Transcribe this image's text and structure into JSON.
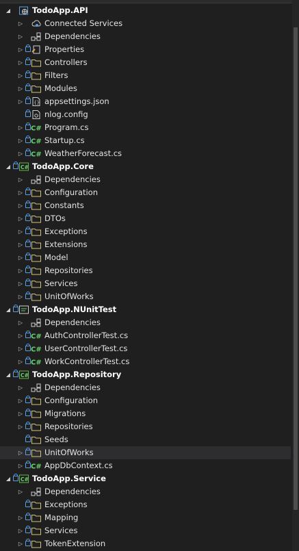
{
  "explorer": {
    "rows": [
      {
        "label": "TodoApp.API",
        "icon": "web-project-icon",
        "expand": "open",
        "lock": false,
        "project": true
      },
      {
        "label": "Connected Services",
        "icon": "connected-services-icon",
        "expand": "closed",
        "lock": false
      },
      {
        "label": "Dependencies",
        "icon": "dependencies-icon",
        "expand": "closed",
        "lock": false
      },
      {
        "label": "Properties",
        "icon": "properties-icon",
        "expand": "closed",
        "lock": true
      },
      {
        "label": "Controllers",
        "icon": "folder-icon",
        "expand": "closed",
        "lock": true
      },
      {
        "label": "Filters",
        "icon": "folder-icon",
        "expand": "closed",
        "lock": true
      },
      {
        "label": "Modules",
        "icon": "folder-icon",
        "expand": "closed",
        "lock": true
      },
      {
        "label": "appsettings.json",
        "icon": "json-file-icon",
        "expand": "closed",
        "lock": true
      },
      {
        "label": "nlog.config",
        "icon": "config-file-icon",
        "expand": "none",
        "lock": true
      },
      {
        "label": "Program.cs",
        "icon": "csharp-file-icon",
        "expand": "closed",
        "lock": true
      },
      {
        "label": "Startup.cs",
        "icon": "csharp-file-icon",
        "expand": "closed",
        "lock": true
      },
      {
        "label": "WeatherForecast.cs",
        "icon": "csharp-file-icon",
        "expand": "closed",
        "lock": true
      },
      {
        "label": "TodoApp.Core",
        "icon": "csharp-project-icon",
        "expand": "open",
        "lock": true,
        "project": true
      },
      {
        "label": "Dependencies",
        "icon": "dependencies-icon",
        "expand": "closed",
        "lock": false
      },
      {
        "label": "Configuration",
        "icon": "folder-icon",
        "expand": "closed",
        "lock": true
      },
      {
        "label": "Constants",
        "icon": "folder-icon",
        "expand": "closed",
        "lock": true
      },
      {
        "label": "DTOs",
        "icon": "folder-icon",
        "expand": "closed",
        "lock": true
      },
      {
        "label": "Exceptions",
        "icon": "folder-icon",
        "expand": "closed",
        "lock": true
      },
      {
        "label": "Extensions",
        "icon": "folder-icon",
        "expand": "closed",
        "lock": true
      },
      {
        "label": "Model",
        "icon": "folder-icon",
        "expand": "closed",
        "lock": true
      },
      {
        "label": "Repositories",
        "icon": "folder-icon",
        "expand": "closed",
        "lock": true
      },
      {
        "label": "Services",
        "icon": "folder-icon",
        "expand": "closed",
        "lock": true
      },
      {
        "label": "UnitOfWorks",
        "icon": "folder-icon",
        "expand": "closed",
        "lock": true
      },
      {
        "label": "TodoApp.NUnitTest",
        "icon": "test-project-icon",
        "expand": "open",
        "lock": true,
        "project": true
      },
      {
        "label": "Dependencies",
        "icon": "dependencies-icon",
        "expand": "closed",
        "lock": false
      },
      {
        "label": "AuthControllerTest.cs",
        "icon": "csharp-file-icon",
        "expand": "closed",
        "lock": true
      },
      {
        "label": "UserControllerTest.cs",
        "icon": "csharp-file-icon",
        "expand": "closed",
        "lock": true
      },
      {
        "label": "WorkControllerTest.cs",
        "icon": "csharp-file-icon",
        "expand": "closed",
        "lock": true
      },
      {
        "label": "TodoApp.Repository",
        "icon": "csharp-project-icon",
        "expand": "open",
        "lock": true,
        "project": true
      },
      {
        "label": "Dependencies",
        "icon": "dependencies-icon",
        "expand": "closed",
        "lock": false
      },
      {
        "label": "Configuration",
        "icon": "folder-icon",
        "expand": "closed",
        "lock": true
      },
      {
        "label": "Migrations",
        "icon": "folder-icon",
        "expand": "closed",
        "lock": true
      },
      {
        "label": "Repositories",
        "icon": "folder-icon",
        "expand": "closed",
        "lock": true
      },
      {
        "label": "Seeds",
        "icon": "folder-icon",
        "expand": "none",
        "lock": true
      },
      {
        "label": "UnitOfWorks",
        "icon": "folder-icon",
        "expand": "closed",
        "lock": true,
        "selected": true
      },
      {
        "label": "AppDbContext.cs",
        "icon": "csharp-file-icon",
        "expand": "closed",
        "lock": true
      },
      {
        "label": "TodoApp.Service",
        "icon": "csharp-project-icon",
        "expand": "open",
        "lock": true,
        "project": true
      },
      {
        "label": "Dependencies",
        "icon": "dependencies-icon",
        "expand": "closed",
        "lock": false
      },
      {
        "label": "Exceptions",
        "icon": "folder-icon",
        "expand": "none",
        "lock": true
      },
      {
        "label": "Mapping",
        "icon": "folder-icon",
        "expand": "closed",
        "lock": true
      },
      {
        "label": "Services",
        "icon": "folder-icon",
        "expand": "closed",
        "lock": true
      },
      {
        "label": "TokenExtension",
        "icon": "folder-icon",
        "expand": "closed",
        "lock": true
      }
    ]
  },
  "glyphs": {
    "expand_open": "◢",
    "expand_closed": "▷",
    "csharp": "C#"
  },
  "colors": {
    "background": "#1f1f1f",
    "text": "#e4e4e4",
    "lock": "#5aa0e6",
    "folder": "#d6c17a",
    "csharp": "#67d36a",
    "project_frame": "#6ab04c",
    "selected_row": "#2d2d30"
  }
}
